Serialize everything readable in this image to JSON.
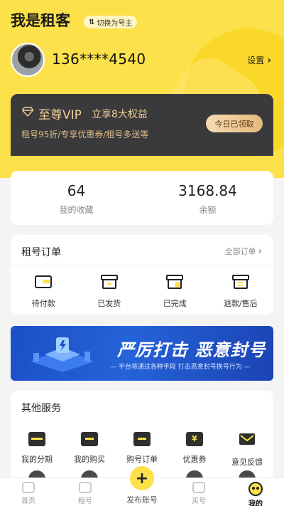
{
  "header": {
    "title": "我是租客",
    "switch_label": "切换为号主",
    "phone": "136****4540",
    "settings_label": "设置"
  },
  "vip": {
    "name": "至尊VIP",
    "perks": "立享8大权益",
    "subtitle": "租号95折/专享优惠券/租号多送等",
    "button_label": "今日已领取"
  },
  "stats": [
    {
      "value": "64",
      "label": "我的收藏"
    },
    {
      "value": "3168.84",
      "label": "余额"
    }
  ],
  "orders": {
    "title": "租号订单",
    "more_label": "全部订单",
    "items": [
      {
        "label": "待付款",
        "icon": "wallet-icon"
      },
      {
        "label": "已发货",
        "icon": "box-icon"
      },
      {
        "label": "已完成",
        "icon": "check-box-icon"
      },
      {
        "label": "退款/售后",
        "icon": "refund-icon"
      }
    ]
  },
  "banner": {
    "title": "严厉打击 恶意封号",
    "subtitle": "— 平台将通过各种手段  打击恶意封号换号行为 —"
  },
  "services": {
    "title": "其他服务",
    "items": [
      {
        "label": "我的分期",
        "icon": "card-icon"
      },
      {
        "label": "我的购买",
        "icon": "cart-icon"
      },
      {
        "label": "购号订单",
        "icon": "order-icon"
      },
      {
        "label": "优惠券",
        "icon": "coupon-icon"
      },
      {
        "label": "意见反馈",
        "icon": "mail-icon"
      }
    ]
  },
  "tabbar": {
    "items": [
      {
        "label": "首页",
        "icon": "home-icon"
      },
      {
        "label": "租号",
        "icon": "rent-icon"
      },
      {
        "label": "发布账号",
        "icon": "plus-icon"
      },
      {
        "label": "买号",
        "icon": "buy-icon"
      },
      {
        "label": "我的",
        "icon": "smile-icon"
      }
    ],
    "active": "我的",
    "accent": "#fce14a"
  }
}
